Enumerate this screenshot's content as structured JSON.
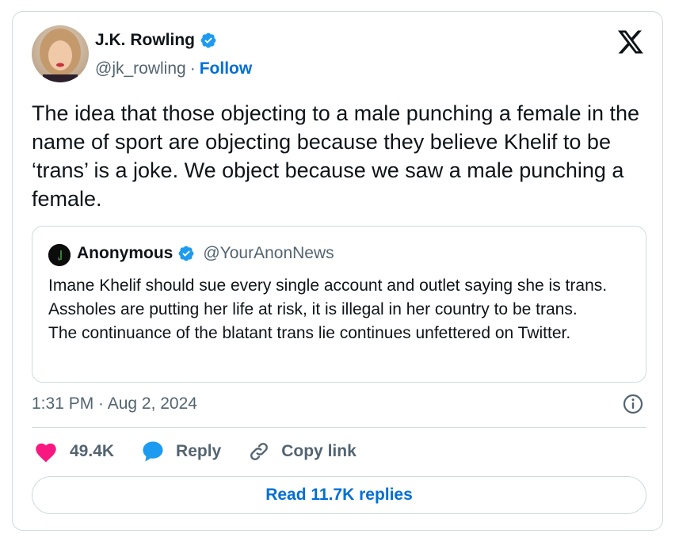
{
  "author": {
    "name": "J.K. Rowling",
    "handle": "@jk_rowling",
    "separator": "·",
    "follow_label": "Follow"
  },
  "tweet": {
    "text": "The idea that those objecting to a male punching a female in the name of sport are objecting because they believe Khelif to be ‘trans’ is a joke. We object because we saw a male punching a female.",
    "timestamp": "1:31 PM · Aug 2, 2024"
  },
  "quoted_tweet": {
    "name": "Anonymous",
    "handle": "@YourAnonNews",
    "lines": [
      "Imane Khelif should sue every single account and outlet saying she is trans.",
      "Assholes are putting her life at risk, it is illegal in her country to be trans.",
      "The continuance of the blatant trans lie continues unfettered on Twitter."
    ]
  },
  "actions": {
    "like_count": "49.4K",
    "reply_label": "Reply",
    "copy_link_label": "Copy link"
  },
  "read_replies_label": "Read 11.7K replies",
  "colors": {
    "brand_blue": "#006fd6",
    "like_pink": "#f91880",
    "reply_blue": "#1d9bf0",
    "verified_blue": "#1d9bf0",
    "text_secondary": "#536471",
    "border": "#cfd9de"
  },
  "icons": [
    "verified-badge-icon",
    "x-logo-icon",
    "info-icon",
    "heart-icon",
    "reply-bubble-icon",
    "link-icon"
  ]
}
